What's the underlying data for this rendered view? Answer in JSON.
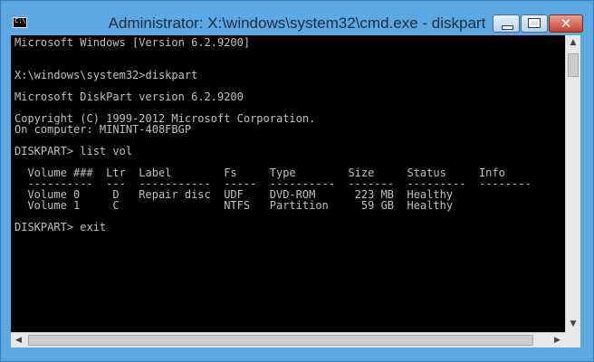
{
  "window": {
    "title": "Administrator: X:\\windows\\system32\\cmd.exe - diskpart",
    "icon_label": "C:\\",
    "close_glyph": "✕"
  },
  "console": {
    "lines": [
      "Microsoft Windows [Version 6.2.9200]",
      "",
      "",
      "X:\\windows\\system32>diskpart",
      "",
      "Microsoft DiskPart version 6.2.9200",
      "",
      "Copyright (C) 1999-2012 Microsoft Corporation.",
      "On computer: MININT-408FBGP",
      "",
      "DISKPART> list vol",
      "",
      "  Volume ###  Ltr  Label        Fs     Type        Size     Status     Info",
      "  ----------  ---  -----------  -----  ----------  -------  ---------  --------",
      "  Volume 0     D   Repair disc  UDF    DVD-ROM      223 MB  Healthy",
      "  Volume 1     C                NTFS   Partition     59 GB  Healthy",
      "",
      "DISKPART> exit"
    ]
  },
  "scrollbar": {
    "up": "▲",
    "down": "▼",
    "left": "◀",
    "right": "▶"
  },
  "colors": {
    "frame": "#5ba8e3",
    "console_bg": "#000000",
    "console_text": "#c0c0c0",
    "close_button": "#c4412c"
  }
}
